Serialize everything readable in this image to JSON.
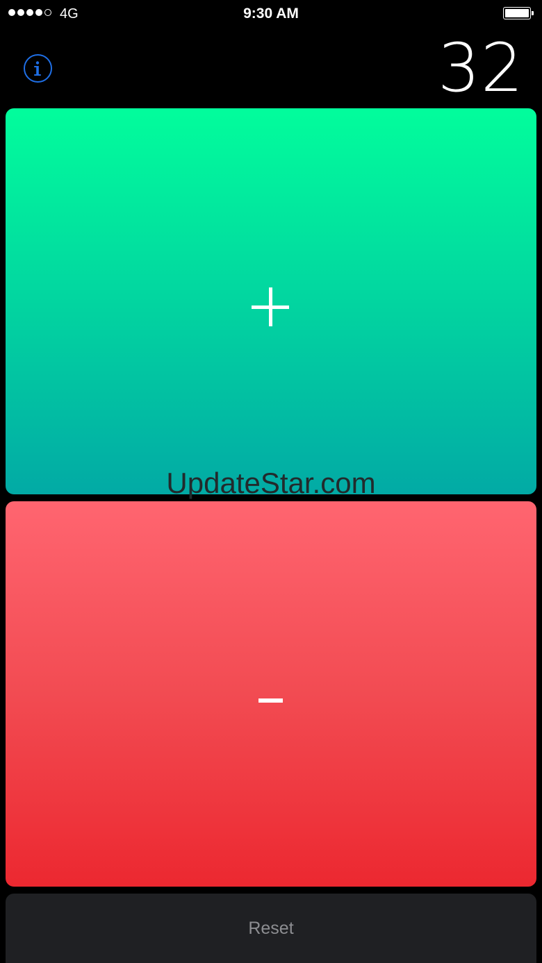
{
  "status_bar": {
    "signal_strength": 4,
    "signal_max": 5,
    "carrier": "4G",
    "time": "9:30 AM",
    "battery_level": 1.0
  },
  "header": {
    "info_icon": "info-circle-icon",
    "count": "32"
  },
  "controls": {
    "increment_symbol": "+",
    "increment_colors": [
      "#02fd9c",
      "#02aaa5"
    ],
    "decrement_symbol": "−",
    "decrement_colors": [
      "#ff6570",
      "#ec2830"
    ],
    "reset_label": "Reset"
  },
  "watermark": "UpdateStar.com"
}
